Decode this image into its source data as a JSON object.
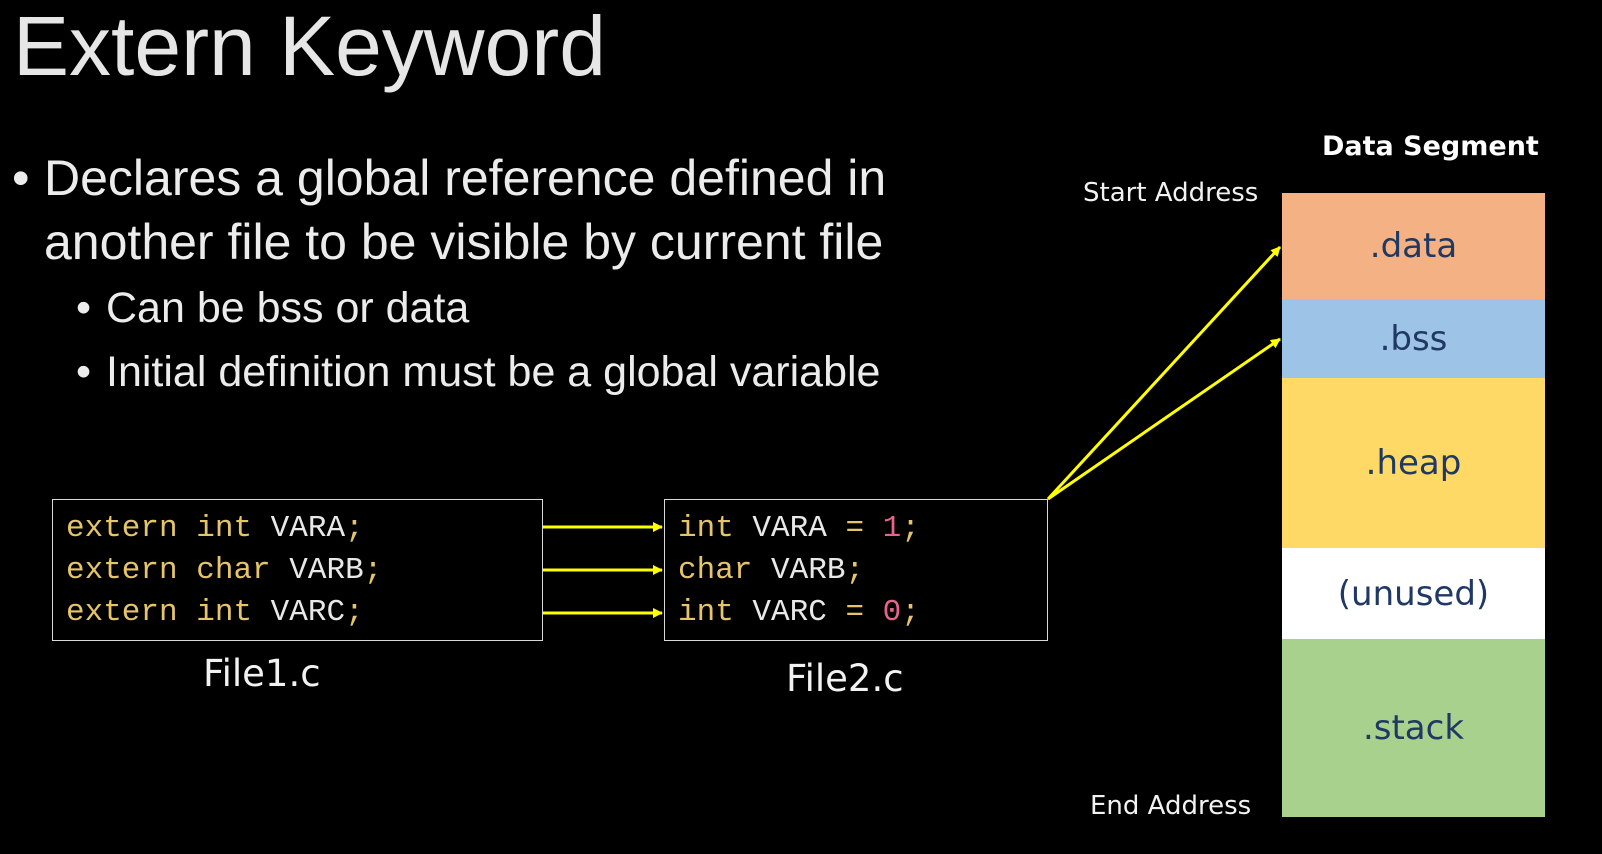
{
  "title": "Extern Keyword",
  "bullets": {
    "main": {
      "dot": "•",
      "line1": "Declares a global reference defined in",
      "line2": "another file to be visible by current file"
    },
    "sub": [
      {
        "dot": "•",
        "text": "Can be bss or data"
      },
      {
        "dot": "•",
        "text": "Initial definition must be a global variable"
      }
    ]
  },
  "file1": {
    "label": "File1.c",
    "lines": [
      {
        "kw1": "extern",
        "kw2": "int",
        "name": "VARA",
        "semi": ";"
      },
      {
        "kw1": "extern",
        "kw2": "char",
        "name": "VARB",
        "semi": ";"
      },
      {
        "kw1": "extern",
        "kw2": "int",
        "name": "VARC",
        "semi": ";"
      }
    ]
  },
  "file2": {
    "label": "File2.c",
    "lines": [
      {
        "kw": "int",
        "name": "VARA",
        "eq": "=",
        "value": "1",
        "semi": ";"
      },
      {
        "kw": "char",
        "name": "VARB",
        "eq": "",
        "value": "",
        "semi": ";"
      },
      {
        "kw": "int",
        "name": "VARC",
        "eq": "=",
        "value": "0",
        "semi": ";"
      }
    ]
  },
  "data_segment": {
    "title": "Data Segment",
    "start_label": "Start Address",
    "end_label": "End Address",
    "segments": [
      {
        "label": ".data",
        "color": "#f4b183"
      },
      {
        "label": ".bss",
        "color": "#9dc3e6"
      },
      {
        "label": ".heap",
        "color": "#ffd966"
      },
      {
        "label": "(unused)",
        "color": "#ffffff"
      },
      {
        "label": ".stack",
        "color": "#a9d18e"
      }
    ]
  },
  "colors": {
    "arrow": "#ffff00",
    "keyword": "#e6c46a",
    "number": "#e8648f"
  }
}
